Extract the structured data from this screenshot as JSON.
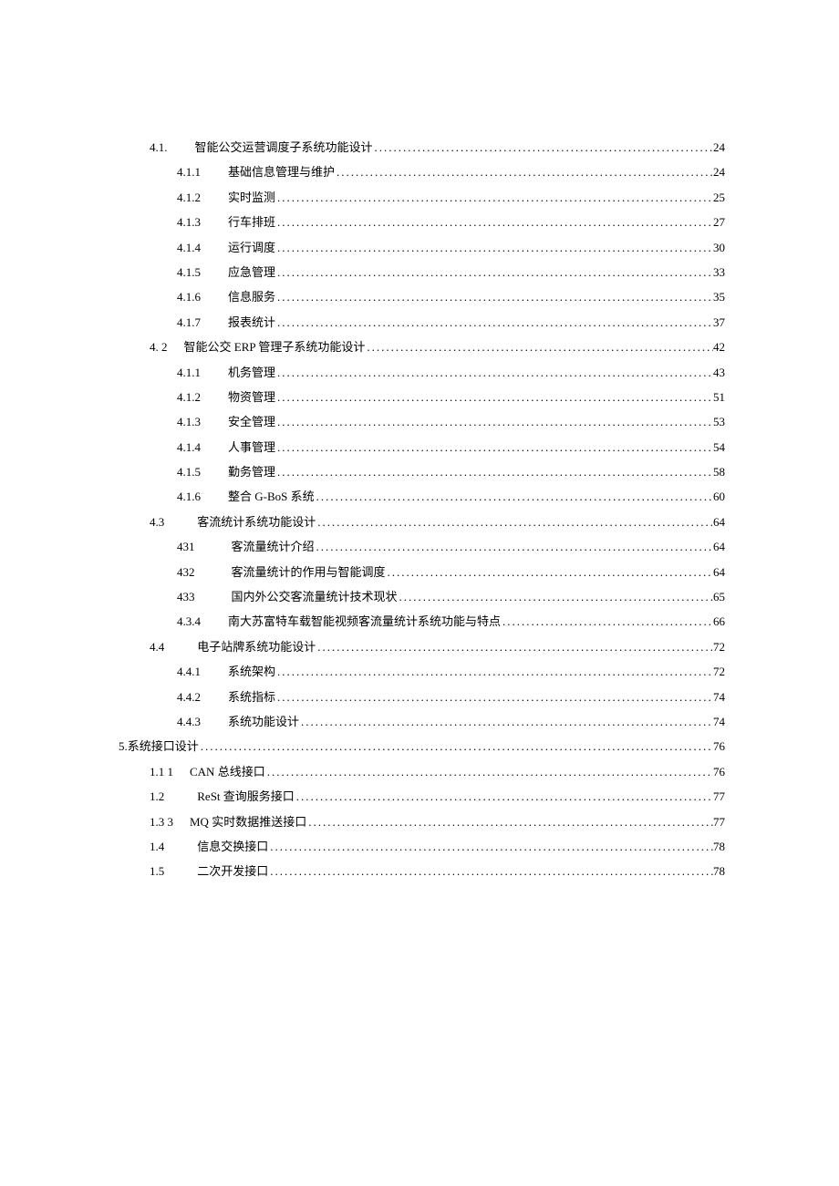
{
  "entries": [
    {
      "level": 2,
      "num": "4.1.",
      "gap": 30,
      "title": "智能公交运营调度子系统功能设计",
      "page": "24"
    },
    {
      "level": 3,
      "num": "4.1.1",
      "gap": 30,
      "title": "基础信息管理与维护",
      "page": "24"
    },
    {
      "level": 3,
      "num": "4.1.2",
      "gap": 30,
      "title": "实时监测",
      "page": "25"
    },
    {
      "level": 3,
      "num": "4.1.3",
      "gap": 30,
      "title": "行车排班",
      "page": "27"
    },
    {
      "level": 3,
      "num": "4.1.4",
      "gap": 30,
      "title": "运行调度",
      "page": "30"
    },
    {
      "level": 3,
      "num": "4.1.5",
      "gap": 30,
      "title": "应急管理",
      "page": "33"
    },
    {
      "level": 3,
      "num": "4.1.6",
      "gap": 30,
      "title": "信息服务",
      "page": "35"
    },
    {
      "level": 3,
      "num": "4.1.7",
      "gap": 30,
      "title": "报表统计",
      "page": "37"
    },
    {
      "level": 2,
      "num": "4.  2",
      "gap": 18,
      "title": "智能公交 ERP 管理子系统功能设计",
      "page": "42"
    },
    {
      "level": 3,
      "num": "4.1.1",
      "gap": 30,
      "title": "机务管理",
      "page": "43"
    },
    {
      "level": 3,
      "num": "4.1.2",
      "gap": 30,
      "title": "物资管理",
      "page": "51"
    },
    {
      "level": 3,
      "num": "4.1.3",
      "gap": 30,
      "title": "安全管理",
      "page": "53"
    },
    {
      "level": 3,
      "num": "4.1.4",
      "gap": 30,
      "title": "人事管理",
      "page": "54"
    },
    {
      "level": 3,
      "num": "4.1.5",
      "gap": 30,
      "title": "勤务管理",
      "page": "58"
    },
    {
      "level": 3,
      "num": "4.1.6",
      "gap": 30,
      "title": "整合 G-BoS 系统",
      "page": "60"
    },
    {
      "level": 2,
      "num": "4.3",
      "gap": 36,
      "title": "客流统计系统功能设计",
      "page": "64"
    },
    {
      "level": 3,
      "num": "431",
      "gap": 40,
      "title": "客流量统计介绍",
      "page": "64"
    },
    {
      "level": 3,
      "num": "432",
      "gap": 40,
      "title": "客流量统计的作用与智能调度",
      "page": "64"
    },
    {
      "level": 3,
      "num": "433",
      "gap": 40,
      "title": "国内外公交客流量统计技术现状",
      "page": "65"
    },
    {
      "level": 3,
      "num": "4.3.4",
      "gap": 30,
      "title": "南大苏富特车载智能视频客流量统计系统功能与特点",
      "page": "66"
    },
    {
      "level": 2,
      "num": "4.4",
      "gap": 36,
      "title": "电子站牌系统功能设计",
      "page": "72"
    },
    {
      "level": 3,
      "num": "4.4.1",
      "gap": 30,
      "title": "系统架构",
      "page": "72"
    },
    {
      "level": 3,
      "num": "4.4.2",
      "gap": 30,
      "title": "系统指标",
      "page": "74"
    },
    {
      "level": 3,
      "num": "4.4.3",
      "gap": 30,
      "title": "系统功能设计",
      "page": "74"
    },
    {
      "level": 1,
      "num": "5.",
      "gap": 0,
      "title": "系统接口设计",
      "page": "76"
    },
    {
      "level": 2,
      "num": "1.1 1",
      "gap": 18,
      "title": "CAN 总线接口",
      "page": "76"
    },
    {
      "level": 2,
      "num": "1.2",
      "gap": 36,
      "title": "ReSt 查询服务接口",
      "page": "77"
    },
    {
      "level": 2,
      "num": "1.3 3",
      "gap": 18,
      "title": "MQ 实时数据推送接口",
      "page": "77"
    },
    {
      "level": 2,
      "num": "1.4",
      "gap": 36,
      "title": "信息交换接口",
      "page": "78"
    },
    {
      "level": 2,
      "num": "1.5",
      "gap": 36,
      "title": "二次开发接口",
      "page": "78"
    }
  ]
}
